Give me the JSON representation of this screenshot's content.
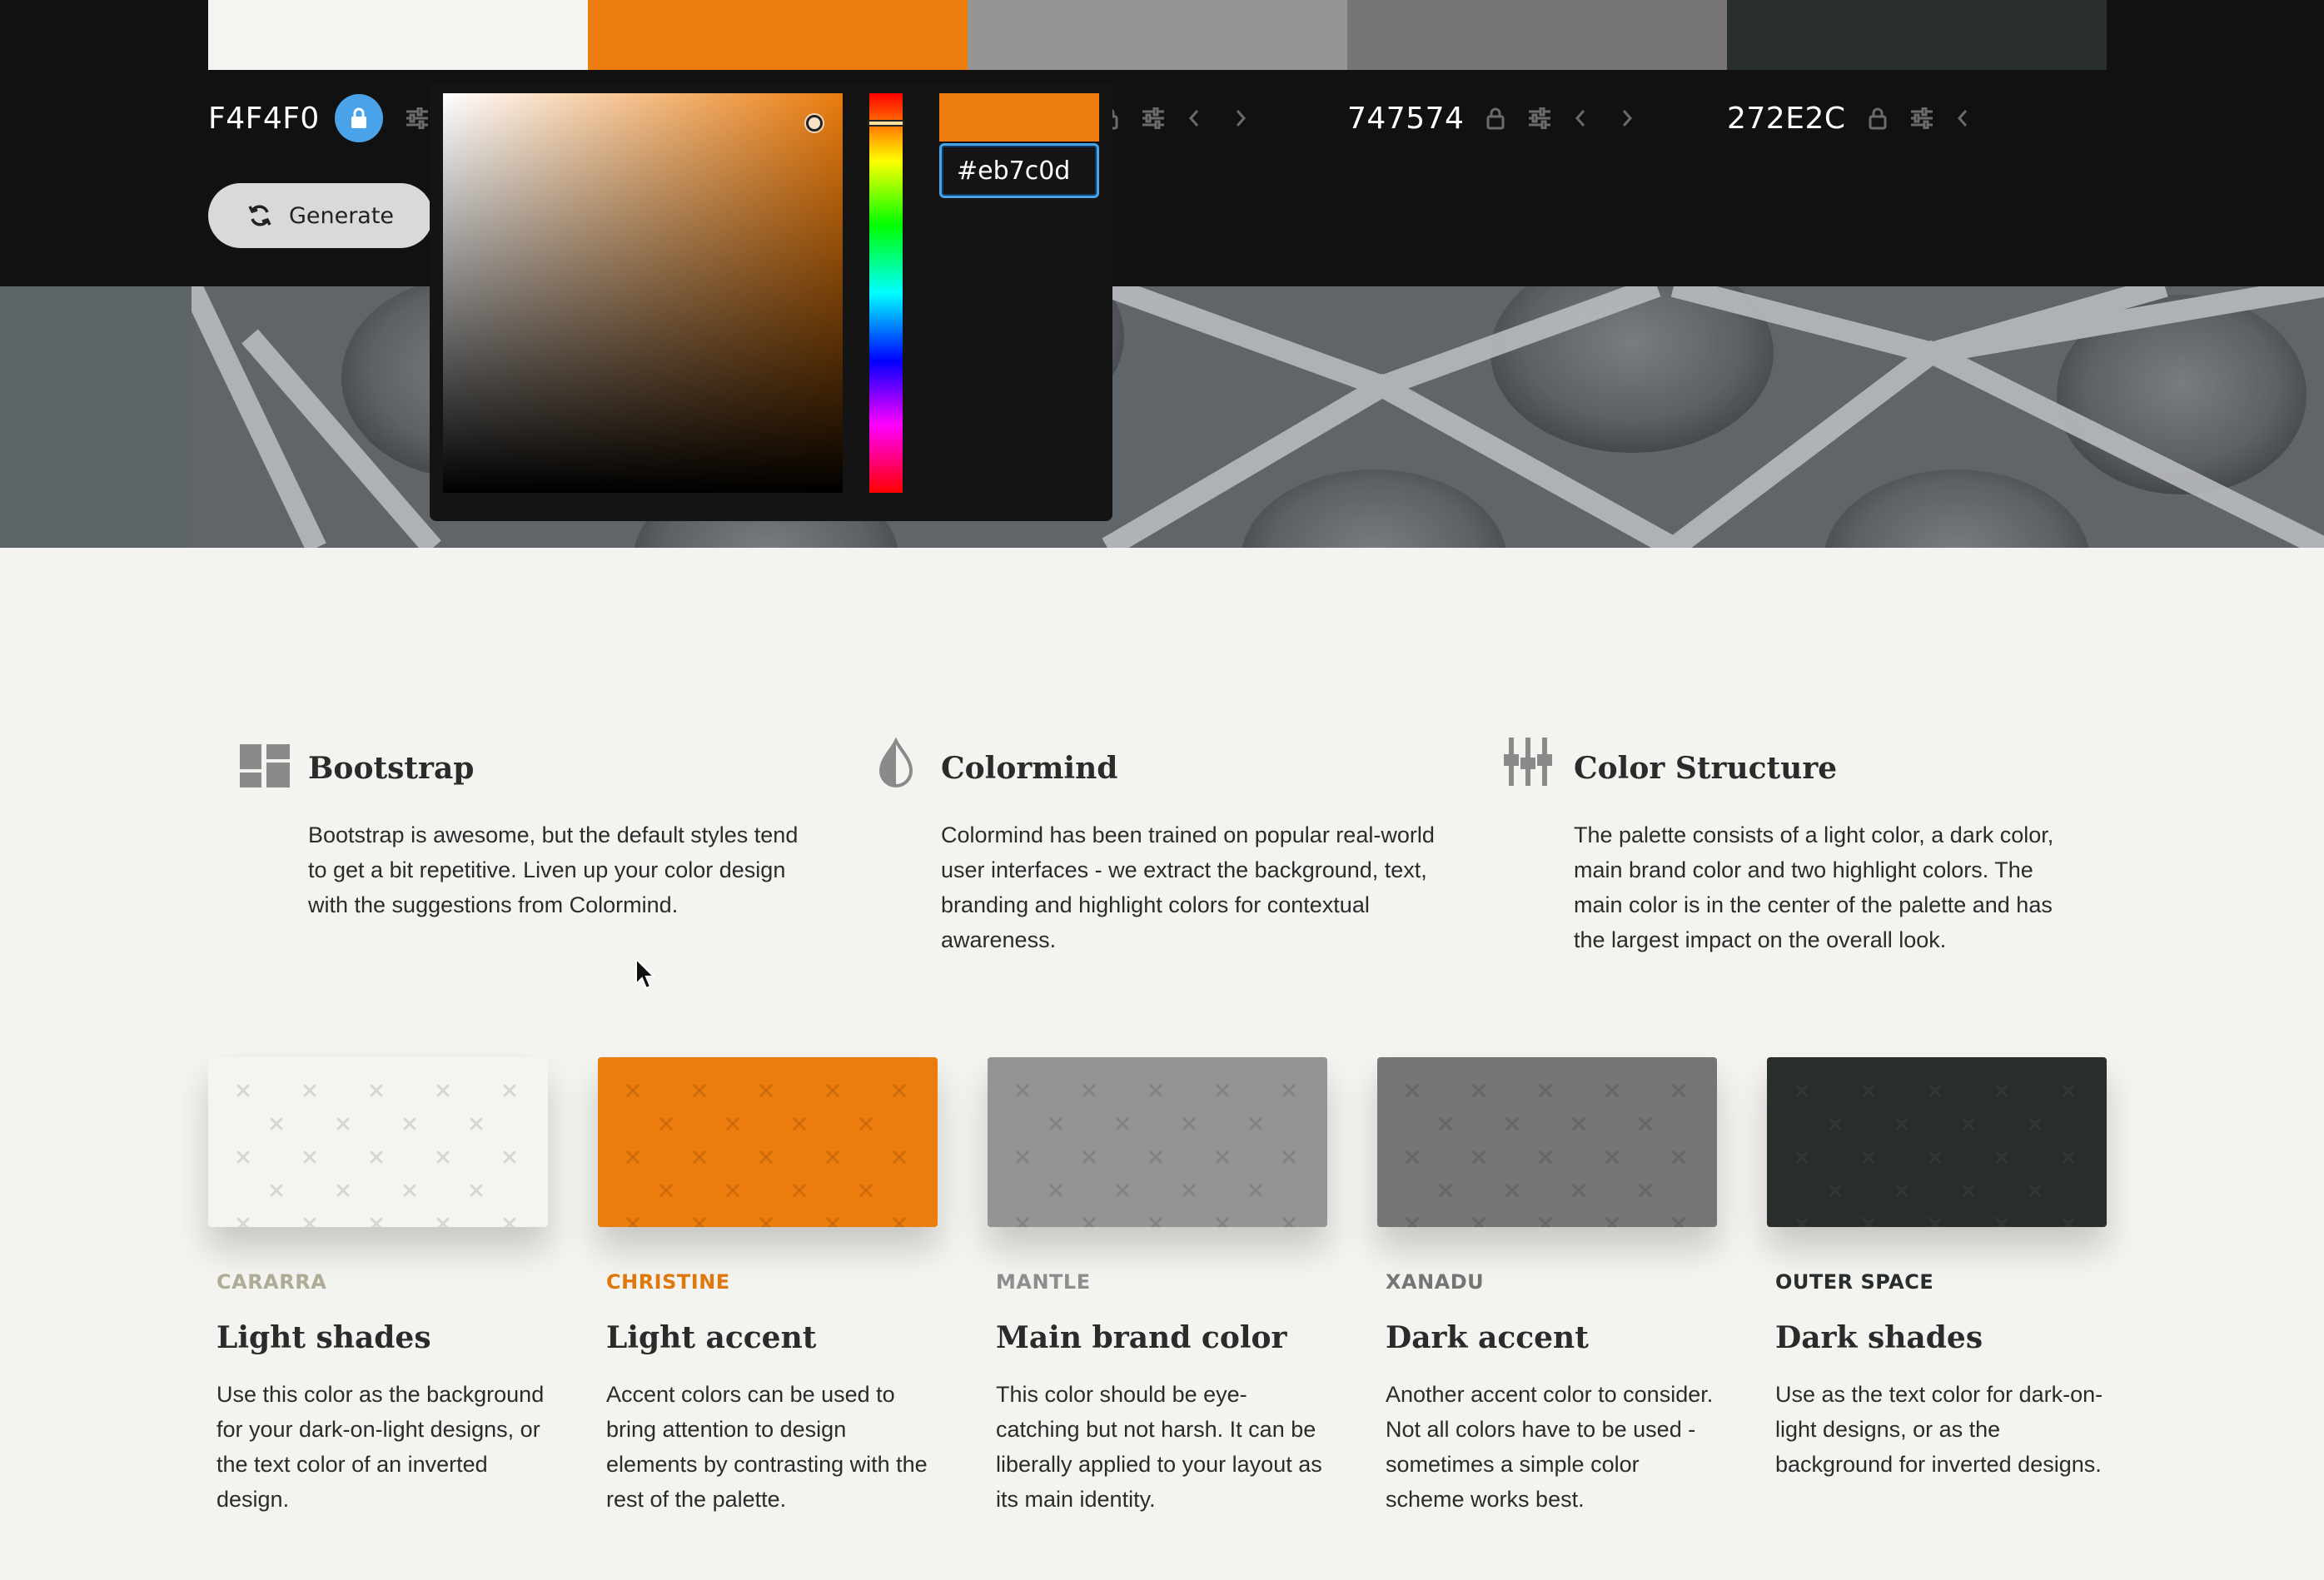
{
  "palette": [
    {
      "hex": "F4F4F0",
      "color": "#f4f4f0",
      "locked": true
    },
    {
      "hex": "",
      "color": "#eb7c0d",
      "locked": false
    },
    {
      "hex": "",
      "color": "#949494",
      "locked": false
    },
    {
      "hex": "747574",
      "color": "#747574",
      "locked": false
    },
    {
      "hex": "272E2C",
      "color": "#272e2c",
      "locked": false
    }
  ],
  "toolbar": {
    "generate_label": "Generate"
  },
  "picker": {
    "hex_value": "#eb7c0d",
    "preview_color": "#eb7c0d"
  },
  "features": [
    {
      "icon": "dashboard-icon",
      "title": "Bootstrap",
      "text": "Bootstrap is awesome, but the default styles tend to get a bit repetitive. Liven up your color design with the suggestions from Colormind."
    },
    {
      "icon": "drop-icon",
      "title": "Colormind",
      "text": "Colormind has been trained on popular real-world user interfaces - we extract the background, text, branding and highlight colors for contextual awareness."
    },
    {
      "icon": "sliders-icon",
      "title": "Color Structure",
      "text": "The palette consists of a light color, a dark color, main brand color and two highlight colors. The main color is in the center of the palette and has the largest impact on the overall look."
    }
  ],
  "cards": [
    {
      "name": "CARARRA",
      "name_color": "#b0ab97",
      "title": "Light shades",
      "text": "Use this color as the background for your dark-on-light designs, or the text color of an inverted design.",
      "color": "#f4f4f0"
    },
    {
      "name": "CHRISTINE",
      "name_color": "#e0780c",
      "title": "Light accent",
      "text": "Accent colors can be used to bring attention to design elements by contrasting with the rest of the palette.",
      "color": "#eb7c0d"
    },
    {
      "name": "MANTLE",
      "name_color": "#8e8e8e",
      "title": "Main brand color",
      "text": "This color should be eye-catching but not harsh. It can be liberally applied to your layout as its main identity.",
      "color": "#949494"
    },
    {
      "name": "XANADU",
      "name_color": "#747574",
      "title": "Dark accent",
      "text": "Another accent color to consider. Not all colors have to be used - sometimes a simple color scheme works best.",
      "color": "#747574"
    },
    {
      "name": "OUTER SPACE",
      "name_color": "#272e2c",
      "title": "Dark shades",
      "text": "Use as the text color for dark-on-light designs, or as the background for inverted designs.",
      "color": "#272e2c"
    }
  ]
}
